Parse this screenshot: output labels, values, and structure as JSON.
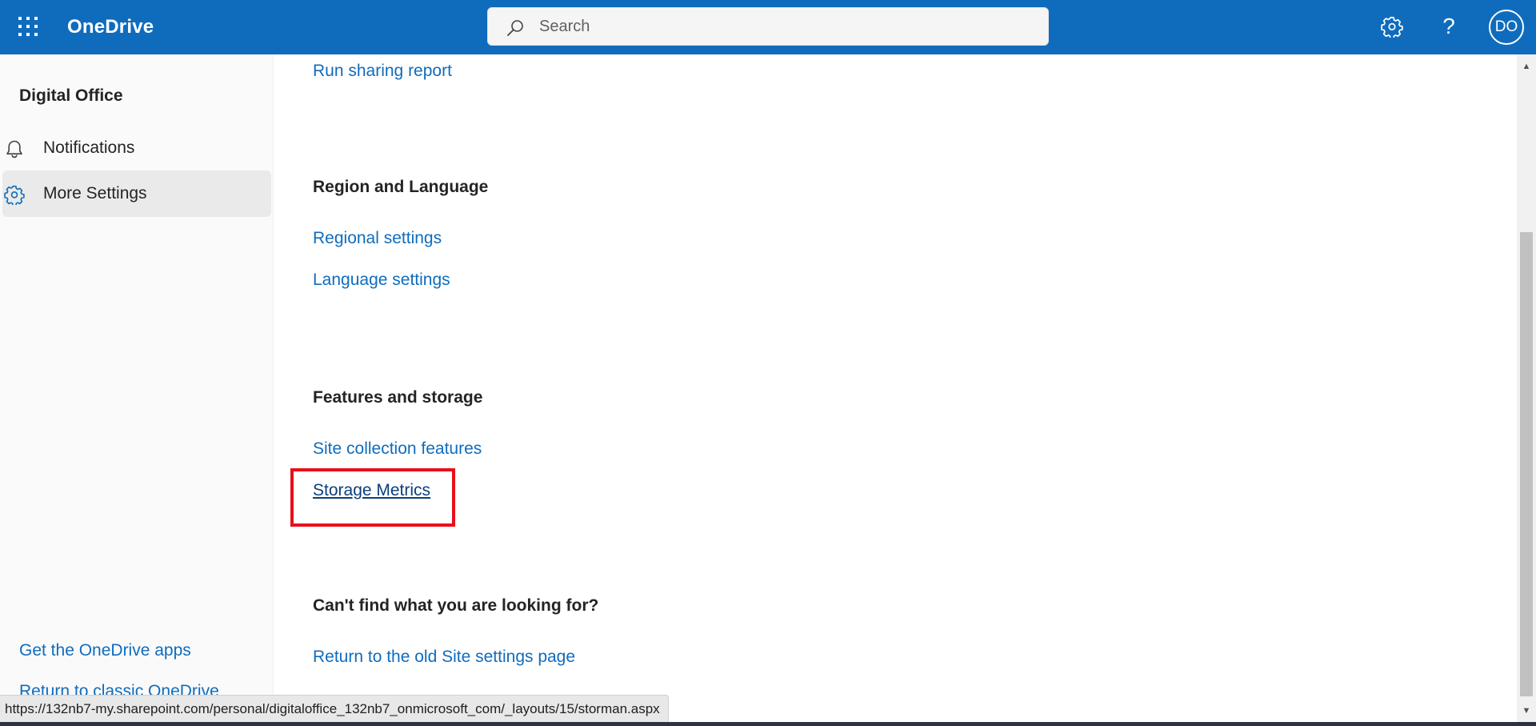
{
  "header": {
    "app_name": "OneDrive",
    "search_placeholder": "Search",
    "avatar_initials": "DO",
    "help_glyph": "?",
    "icons": [
      "waffle-icon",
      "search-icon",
      "gear-icon",
      "help-icon"
    ],
    "brand_color": "#0f6cbd"
  },
  "sidebar": {
    "site_title": "Digital Office",
    "items": [
      {
        "label": "Notifications",
        "icon": "bell-icon",
        "selected": false
      },
      {
        "label": "More Settings",
        "icon": "gear-icon",
        "selected": true
      }
    ],
    "footer_links": [
      "Get the OneDrive apps",
      "Return to classic OneDrive"
    ]
  },
  "main": {
    "run_sharing_report": "Run sharing report",
    "region_section": {
      "title": "Region and Language",
      "links": [
        "Regional settings",
        "Language settings"
      ]
    },
    "features_section": {
      "title": "Features and storage",
      "links": [
        "Site collection features",
        "Storage Metrics"
      ],
      "highlighted_link": "Storage Metrics",
      "highlight_color": "#e8101a"
    },
    "help_section": {
      "title": "Can't find what you are looking for?",
      "links": [
        "Return to the old Site settings page"
      ]
    }
  },
  "status_bar": {
    "url": "https://132nb7-my.sharepoint.com/personal/digitaloffice_132nb7_onmicrosoft_com/_layouts/15/storman.aspx"
  }
}
